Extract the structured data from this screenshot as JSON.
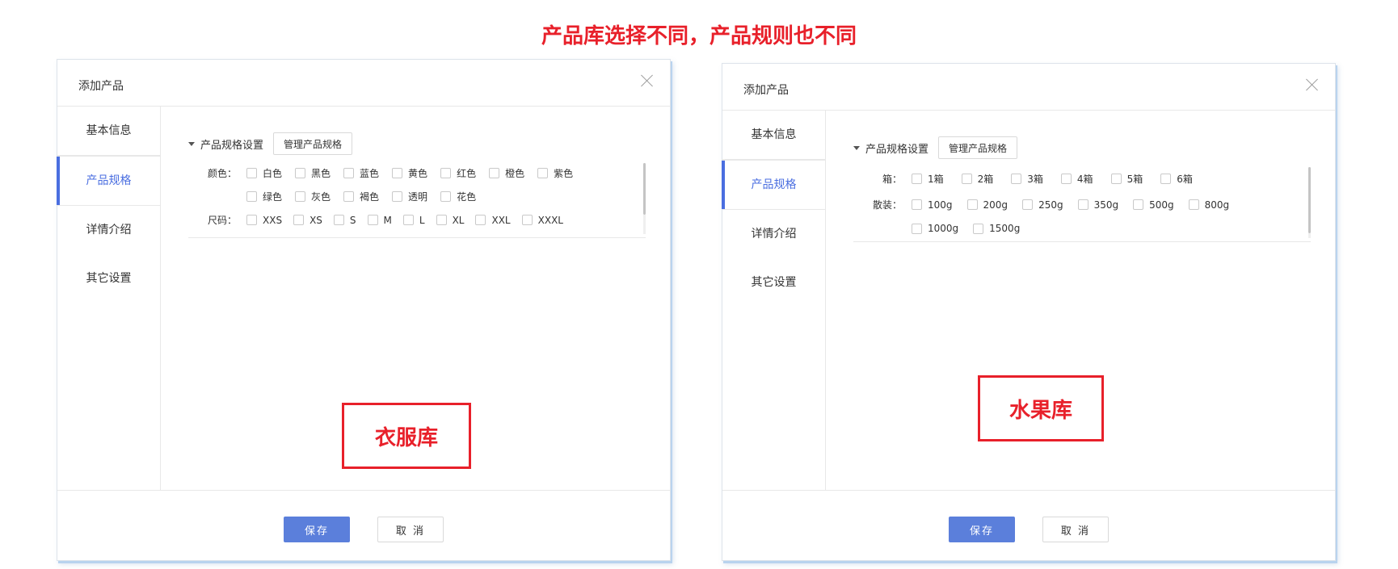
{
  "headline": "产品库选择不同，产品规则也不同",
  "dialogs": [
    {
      "title": "添加产品",
      "nav": [
        {
          "label": "基本信息"
        },
        {
          "label": "产品规格"
        },
        {
          "label": "详情介绍"
        },
        {
          "label": "其它设置"
        }
      ],
      "active_nav": "产品规格",
      "spec_header": "产品规格设置",
      "manage_button": "管理产品规格",
      "rows": [
        {
          "label": "颜色：",
          "options": [
            "白色",
            "黑色",
            "蓝色",
            "黄色",
            "红色",
            "橙色",
            "紫色"
          ]
        },
        {
          "label": "",
          "options": [
            "绿色",
            "灰色",
            "褐色",
            "透明",
            "花色"
          ]
        },
        {
          "label": "尺码：",
          "options": [
            "XXS",
            "XS",
            "S",
            "M",
            "L",
            "XL",
            "XXL",
            "XXXL"
          ]
        }
      ],
      "annotation": "衣服库",
      "save": "保存",
      "cancel": "取 消"
    },
    {
      "title": "添加产品",
      "nav": [
        {
          "label": "基本信息"
        },
        {
          "label": "产品规格"
        },
        {
          "label": "详情介绍"
        },
        {
          "label": "其它设置"
        }
      ],
      "active_nav": "产品规格",
      "spec_header": "产品规格设置",
      "manage_button": "管理产品规格",
      "rows": [
        {
          "label": "箱：",
          "options": [
            "1箱",
            "2箱",
            "3箱",
            "4箱",
            "5箱",
            "6箱"
          ]
        },
        {
          "label": "散装：",
          "options": [
            "100g",
            "200g",
            "250g",
            "350g",
            "500g",
            "800g"
          ]
        },
        {
          "label": "",
          "options": [
            "1000g",
            "1500g"
          ]
        }
      ],
      "annotation": "水果库",
      "save": "保存",
      "cancel": "取 消"
    }
  ],
  "colors": {
    "accent": "#5b7fdb",
    "annotation": "#e8202a"
  }
}
